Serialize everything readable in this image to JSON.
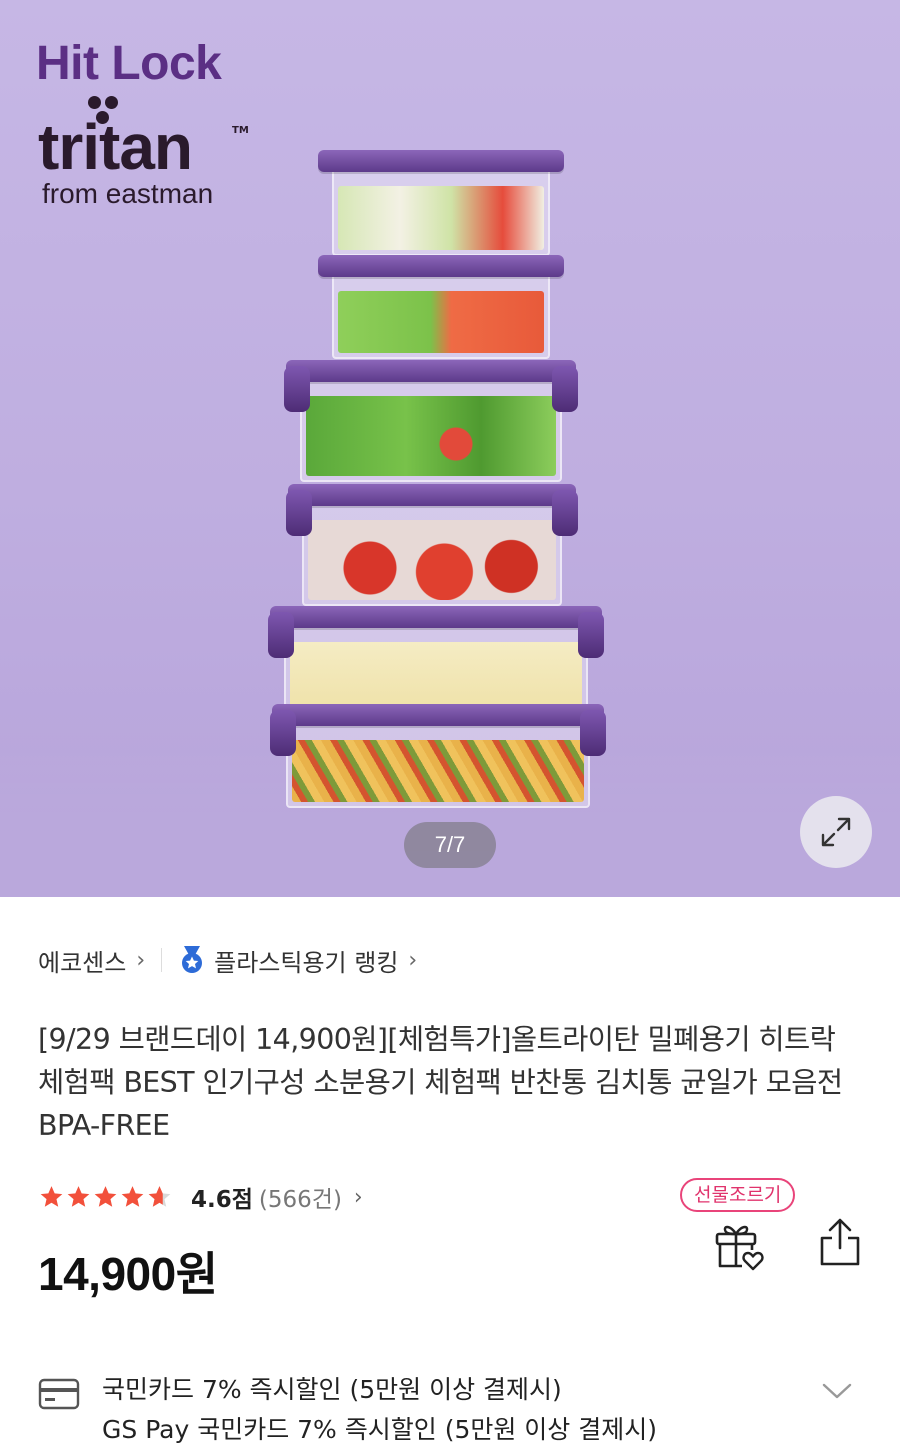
{
  "hero": {
    "brand_name": "Hit Lock",
    "brand_material": "tritan",
    "brand_trademark": "TM",
    "brand_from": "from eastman",
    "page_indicator": "7/7",
    "background_color": "#c2b3e3",
    "lid_color": "#6b4599"
  },
  "breadcrumb": {
    "seller": "에코센스",
    "ranking": "플라스틱용기 랭킹"
  },
  "product": {
    "title": "[9/29 브랜드데이 14,900원][체험특가]올트라이탄 밀폐용기 히트락 체험팩 BEST 인기구성 소분용기 체험팩 반찬통 김치통 균일가 모음전 BPA-FREE",
    "rating": "4.6점",
    "rating_stars": 4.6,
    "review_count": "(566건)",
    "price": "14,900원"
  },
  "actions": {
    "gift_badge": "선물조르기",
    "accent_color": "#e9447a"
  },
  "benefits": {
    "line1": "국민카드 7% 즉시할인 (5만원 이상 결제시)",
    "line2": "GS Pay 국민카드 7% 즉시할인 (5만원 이상 결제시)"
  }
}
